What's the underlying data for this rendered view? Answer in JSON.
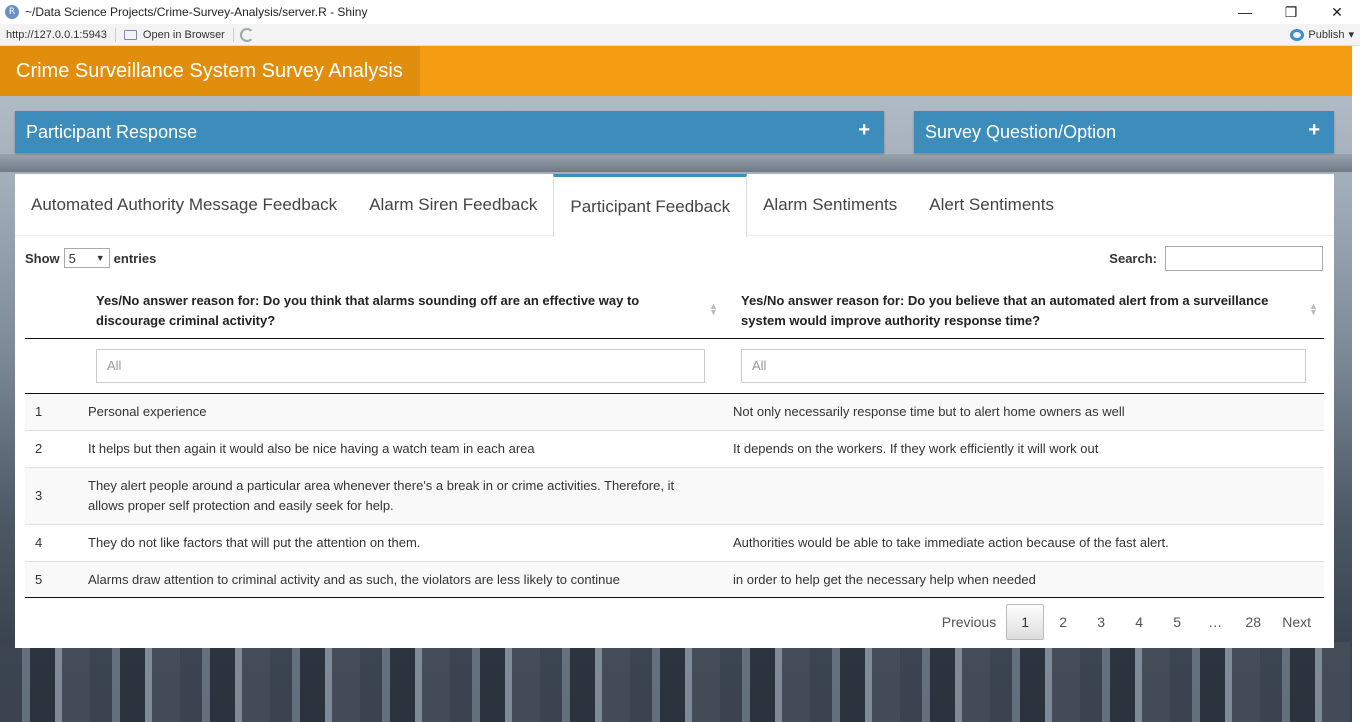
{
  "window": {
    "title": "~/Data Science Projects/Crime-Survey-Analysis/server.R - Shiny",
    "controls": {
      "minimize": "—",
      "restore": "❐",
      "close": "✕"
    }
  },
  "toolbar": {
    "url": "http://127.0.0.1:5943",
    "open_in_browser": "Open in Browser",
    "publish": "Publish",
    "publish_caret": "▾"
  },
  "header": {
    "title": "Crime Surveillance System Survey Analysis"
  },
  "boxes": [
    {
      "label": "Participant Response",
      "icon": "+"
    },
    {
      "label": "Survey Question/Option",
      "icon": "+"
    }
  ],
  "tabs": [
    {
      "label": "Automated Authority Message Feedback"
    },
    {
      "label": "Alarm Siren Feedback"
    },
    {
      "label": "Participant Feedback",
      "active": true
    },
    {
      "label": "Alarm Sentiments"
    },
    {
      "label": "Alert Sentiments"
    }
  ],
  "table_controls": {
    "show_label": "Show",
    "entries_value": "5",
    "entries_label": "entries",
    "search_label": "Search:",
    "search_value": ""
  },
  "columns": [
    "Yes/No answer reason for: Do you think that alarms sounding off are an effective way to discourage criminal activity?",
    "Yes/No answer reason for: Do you believe that an automated alert from a surveillance system would improve authority response time?"
  ],
  "filters": [
    "All",
    "All"
  ],
  "rows": [
    {
      "idx": "1",
      "c1": "Personal experience",
      "c2": "Not only necessarily response time but to alert home owners as well"
    },
    {
      "idx": "2",
      "c1": "It helps but then again it would also be nice having a watch team in each area",
      "c2": "It depends on the workers. If they work efficiently it will work out"
    },
    {
      "idx": "3",
      "c1": "They alert people around a particular area whenever there's a break in or crime activities. Therefore, it allows proper self protection and easily seek for help.",
      "c2": ""
    },
    {
      "idx": "4",
      "c1": "They do not like factors that will put the attention on them.",
      "c2": "Authorities would be able to take immediate action because of the fast alert."
    },
    {
      "idx": "5",
      "c1": "Alarms draw attention to criminal activity and as such, the violators are less likely to continue",
      "c2": "in order to help get the necessary help when needed"
    }
  ],
  "pagination": {
    "previous": "Previous",
    "pages": [
      "1",
      "2",
      "3",
      "4",
      "5",
      "…",
      "28"
    ],
    "current": "1",
    "next": "Next"
  }
}
